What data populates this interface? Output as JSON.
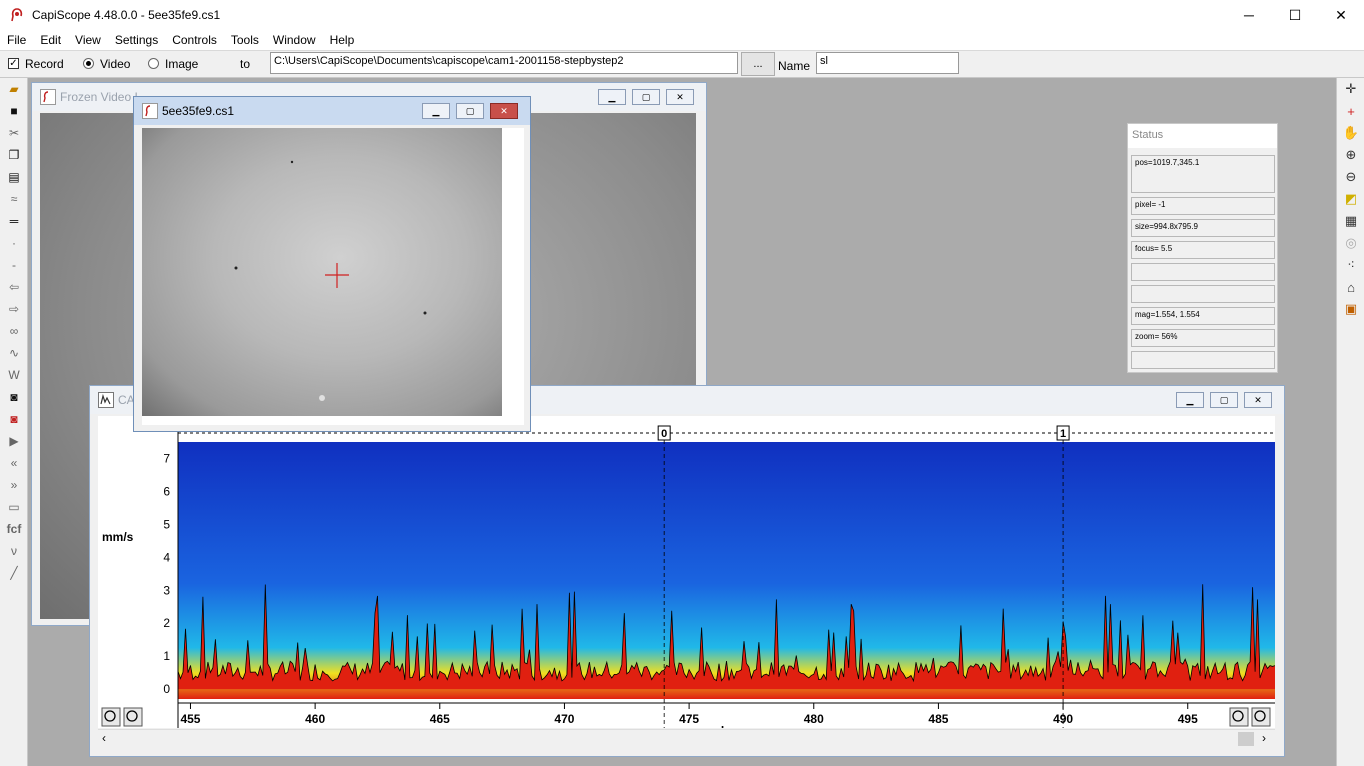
{
  "window": {
    "title": "CapiScope 4.48.0.0 - 5ee35fe9.cs1",
    "minimize": "─",
    "maximize": "☐",
    "close": "✕"
  },
  "menu": [
    "File",
    "Edit",
    "View",
    "Settings",
    "Controls",
    "Tools",
    "Window",
    "Help"
  ],
  "controls": {
    "record_label": "Record",
    "record_checked": true,
    "video_label": "Video",
    "image_label": "Image",
    "to_label": "to",
    "path": "C:\\Users\\CapiScope\\Documents\\capiscope\\cam1-2001158-stepbystep2",
    "browse_label": "...",
    "name_label": "Name",
    "name_value": "sl"
  },
  "windows": {
    "frozen": {
      "title": "Frozen Video I"
    },
    "image": {
      "title": "5ee35fe9.cs1"
    },
    "plot": {
      "title": "CA"
    }
  },
  "status": {
    "title": "Status",
    "rows": [
      "pos=1019.7,345.1",
      "pixel= -1",
      "size=994.8x795.9",
      "focus=  5.5",
      "",
      "",
      "mag=1.554, 1.554",
      "zoom=  56%",
      ""
    ]
  },
  "chart_data": {
    "type": "heatmap",
    "xlabel": "seconds",
    "ylabel": "mm/s",
    "xlim": [
      454.5,
      498.5
    ],
    "ylim": [
      -0.3,
      7.5
    ],
    "x_ticks": [
      455,
      460,
      465,
      470,
      475,
      480,
      485,
      490,
      495
    ],
    "y_ticks": [
      0,
      1,
      2,
      3,
      4,
      5,
      6,
      7
    ],
    "markers": [
      {
        "label": "0",
        "x": 474
      },
      {
        "label": "1",
        "x": 490
      }
    ],
    "colormap": [
      "#1030c0",
      "#1a64e0",
      "#20b8e8",
      "#40e0a0",
      "#f0e020",
      "#e02010"
    ]
  }
}
